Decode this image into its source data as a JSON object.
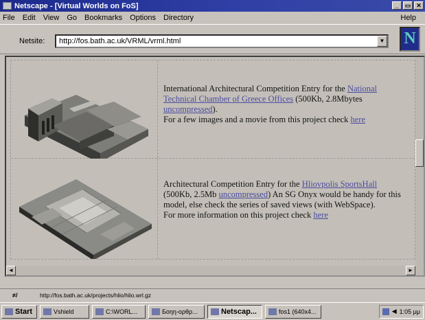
{
  "window": {
    "title": "Netscape - [Virtual Worlds on FoS]",
    "buttons": [
      "_",
      "▭",
      "✕"
    ]
  },
  "menu": {
    "items": [
      "File",
      "Edit",
      "View",
      "Go",
      "Bookmarks",
      "Options",
      "Directory"
    ],
    "help": "Help"
  },
  "location": {
    "label": "Netsite:",
    "url": "http://fos.bath.ac.uk/VRML/vrml.html",
    "throbber": "N"
  },
  "content": {
    "rows": [
      {
        "text_before": "International Architectural Competition Entry for the ",
        "link1": "National Technical Chamber of Greece Offices",
        "text_mid": " (500Kb, 2.8Mbytes ",
        "link2": "uncompressed",
        "text_after": ").",
        "more_prefix": "For a few images and a movie from this project check ",
        "more_link": "here"
      },
      {
        "text_before": "Architectural Competition Entry for the ",
        "link1": "Hliovpolis SportsHall",
        "text_mid": " (500Kb, 2.5Mb ",
        "link2": "uncompressed",
        "text_after": ") An SG Onyx would be handy for this model, else check the series of saved views (with WebSpace).",
        "more_prefix": "For more information on this project check ",
        "more_link": "here"
      }
    ]
  },
  "status": {
    "lock": "≠/",
    "text": "http://fos.bath.ac.uk/projects/hlio/hlio.wrl.gz"
  },
  "taskbar": {
    "start": "Start",
    "tasks": [
      "Vshield",
      "C:\\WORL...",
      "Бοηη-ορθρ...",
      "Netscap...",
      "fos1 (640x4..."
    ],
    "active_index": 3,
    "clock": "1:05 μμ"
  },
  "colors": {
    "titlebar": "#1c2a8c",
    "link": "#4b4ba0",
    "background": "#c3bfb8"
  }
}
